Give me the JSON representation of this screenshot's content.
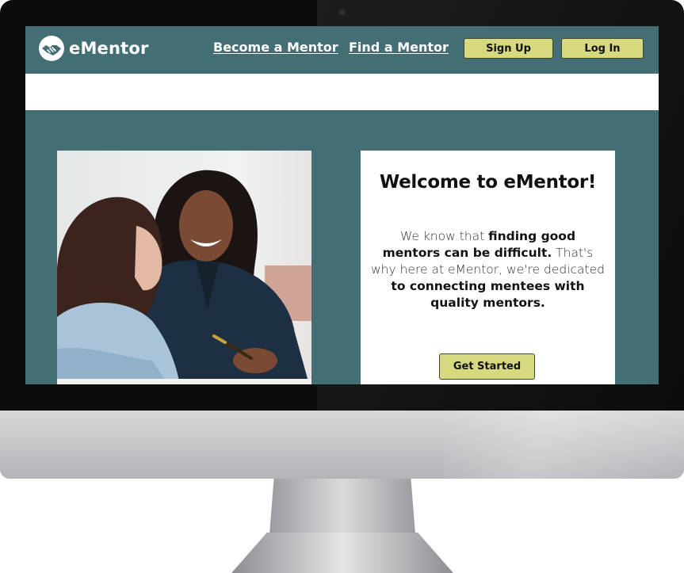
{
  "brand": {
    "name": "eMentor",
    "logo_icon": "handshake-icon"
  },
  "nav": {
    "links": [
      {
        "label": "Become a Mentor"
      },
      {
        "label": "Find a Mentor"
      }
    ],
    "signup_label": "Sign Up",
    "login_label": "Log In"
  },
  "hero": {
    "image_alt": "Two women smiling while reviewing notes together",
    "card": {
      "title": "Welcome to eMentor!",
      "body_parts": [
        "We know that ",
        "finding good mentors can be difficult.",
        " That's why here at eMentor, we're dedicated ",
        "to connecting mentees with quality mentors."
      ],
      "cta_label": "Get Started"
    }
  },
  "colors": {
    "primary": "#436e73",
    "button": "#d6d97f",
    "white": "#ffffff"
  }
}
